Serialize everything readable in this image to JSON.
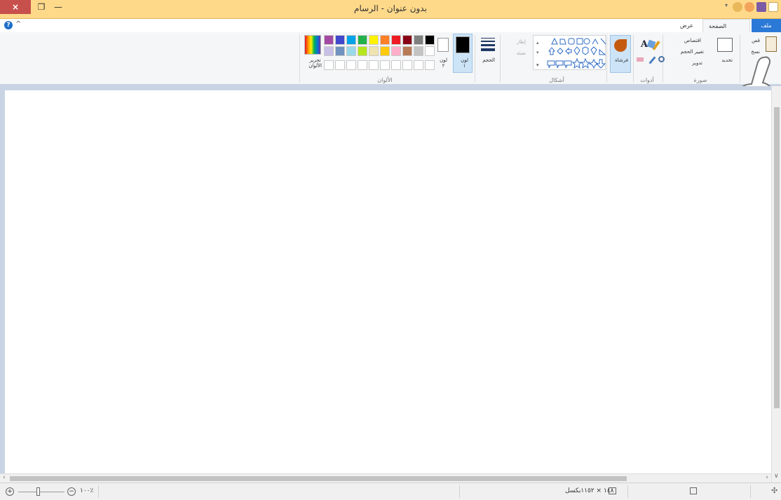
{
  "window": {
    "title": "بدون عنوان - الرسام",
    "close_label": "×",
    "restore_label": "❐",
    "minimize_label": "—"
  },
  "tabs": [
    {
      "label": "ملف"
    },
    {
      "label": "الصفحة الرئيسية"
    },
    {
      "label": "عرض"
    }
  ],
  "help_label": "?",
  "collapse_label": "^",
  "ribbon": {
    "clipboard": {
      "paste": "لصق",
      "cut": "قص",
      "copy": "نسخ"
    },
    "image": {
      "group_label": "صورة",
      "select": "تحديد",
      "crop": "اقتصاص",
      "resize": "تغيير الحجم",
      "rotate": "تدوير"
    },
    "tools": {
      "group_label": "أدوات",
      "text_glyph": "A"
    },
    "brushes": {
      "label": "فرشاة"
    },
    "shapes": {
      "group_label": "أشكال",
      "outline": "إطار",
      "fill": "تعبئة"
    },
    "size": {
      "label": "الحجم"
    },
    "colors": {
      "group_label": "الألوان",
      "color1": "لون\n١",
      "color2": "لون\n٢",
      "edit_colors": "تحرير\nالألوان",
      "row1": [
        "#000000",
        "#7f7f7f",
        "#880015",
        "#ed1c24",
        "#ff7f27",
        "#fff200",
        "#22b14c",
        "#00a2e8",
        "#3f48cc",
        "#a349a4"
      ],
      "row2": [
        "#ffffff",
        "#c3c3c3",
        "#b97a57",
        "#ffaec9",
        "#ffc90e",
        "#efe4b0",
        "#b5e61d",
        "#99d9ea",
        "#7092be",
        "#c8bfe7"
      ]
    }
  },
  "status": {
    "dimensions": "١٤٨ × ١١٥٢بكسل",
    "zoom": "١٠٠٪"
  },
  "theme": {
    "title_bg": "#ffd98a",
    "file_tab": "#2b79d6",
    "close_btn": "#c7504d"
  }
}
